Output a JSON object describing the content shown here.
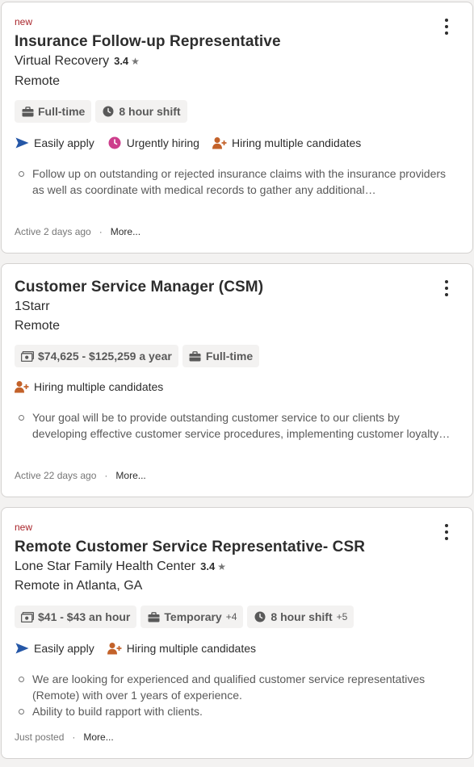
{
  "cards": [
    {
      "new_label": "new",
      "title": "Insurance Follow-up Representative",
      "company": "Virtual Recovery",
      "rating": "3.4",
      "location": "Remote",
      "pills": [
        {
          "icon": "briefcase-icon",
          "label": "Full-time"
        },
        {
          "icon": "clock-icon",
          "label": "8 hour shift"
        }
      ],
      "attributes": [
        "Easily apply",
        "Urgently hiring",
        "Hiring multiple candidates"
      ],
      "snippet": [
        "Follow up on outstanding or rejected insurance claims with the insurance providers as well as coordinate with medical records to gather any additional…"
      ],
      "posted": "Active 2 days ago",
      "more_label": "More..."
    },
    {
      "title": "Customer Service Manager (CSM)",
      "company": "1Starr",
      "location": "Remote",
      "pills": [
        {
          "icon": "money-icon",
          "label": "$74,625 - $125,259 a year"
        },
        {
          "icon": "briefcase-icon",
          "label": "Full-time"
        }
      ],
      "attributes": [
        "Hiring multiple candidates"
      ],
      "snippet": [
        "Your goal will be to provide outstanding customer service to our clients by developing effective customer service procedures, implementing customer loyalty…"
      ],
      "posted": "Active 22 days ago",
      "more_label": "More..."
    },
    {
      "new_label": "new",
      "title": "Remote Customer Service Representative- CSR",
      "company": "Lone Star Family Health Center",
      "rating": "3.4",
      "location": "Remote in Atlanta, GA",
      "pills": [
        {
          "icon": "money-icon",
          "label": "$41 - $43 an hour"
        },
        {
          "icon": "briefcase-icon",
          "label": "Temporary",
          "extra": "+4"
        },
        {
          "icon": "clock-icon",
          "label": "8 hour shift",
          "extra": "+5"
        }
      ],
      "attributes": [
        "Easily apply",
        "Hiring multiple candidates"
      ],
      "snippet": [
        "We are looking for experienced and qualified customer service representatives (Remote) with over 1 years of experience.",
        "Ability to build rapport with clients."
      ],
      "posted": "Just posted",
      "more_label": "More..."
    }
  ],
  "colors": {
    "new_label": "#a9252b",
    "easily_apply": "#2557a7",
    "urgent": "#cd3e8c",
    "hiring_multiple": "#c3622a"
  }
}
